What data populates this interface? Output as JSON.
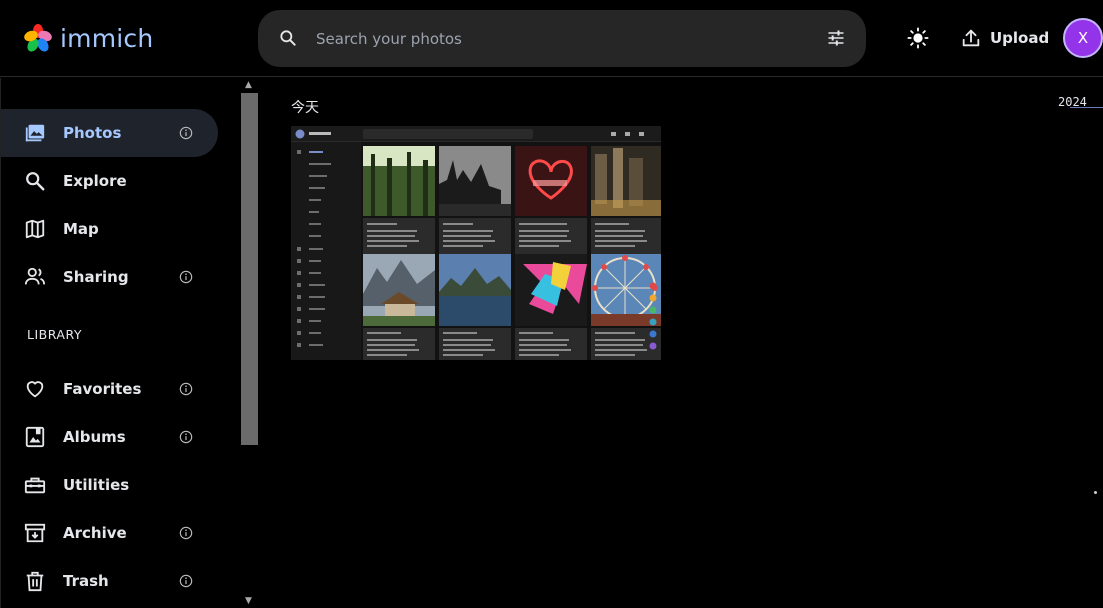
{
  "app": {
    "name": "immich"
  },
  "header": {
    "search_placeholder": "Search your photos",
    "upload_label": "Upload",
    "avatar_initial": "X"
  },
  "sidebar": {
    "items": [
      {
        "label": "Photos",
        "icon": "photos-icon",
        "info": true,
        "active": true
      },
      {
        "label": "Explore",
        "icon": "explore-search-icon",
        "info": false
      },
      {
        "label": "Map",
        "icon": "map-icon",
        "info": false
      },
      {
        "label": "Sharing",
        "icon": "sharing-users-icon",
        "info": true
      }
    ],
    "section_title": "LIBRARY",
    "library": [
      {
        "label": "Favorites",
        "icon": "heart-icon",
        "info": true
      },
      {
        "label": "Albums",
        "icon": "album-icon",
        "info": true
      },
      {
        "label": "Utilities",
        "icon": "toolbox-icon",
        "info": false
      },
      {
        "label": "Archive",
        "icon": "archive-icon",
        "info": true
      },
      {
        "label": "Trash",
        "icon": "trash-icon",
        "info": true
      }
    ]
  },
  "timeline": {
    "group_title": "今天",
    "year_marker": "2024"
  },
  "colors": {
    "accent": "#a5c8ff",
    "avatar_bg": "#9333ea",
    "active_bg": "#1f232b",
    "search_bg": "#262626"
  }
}
